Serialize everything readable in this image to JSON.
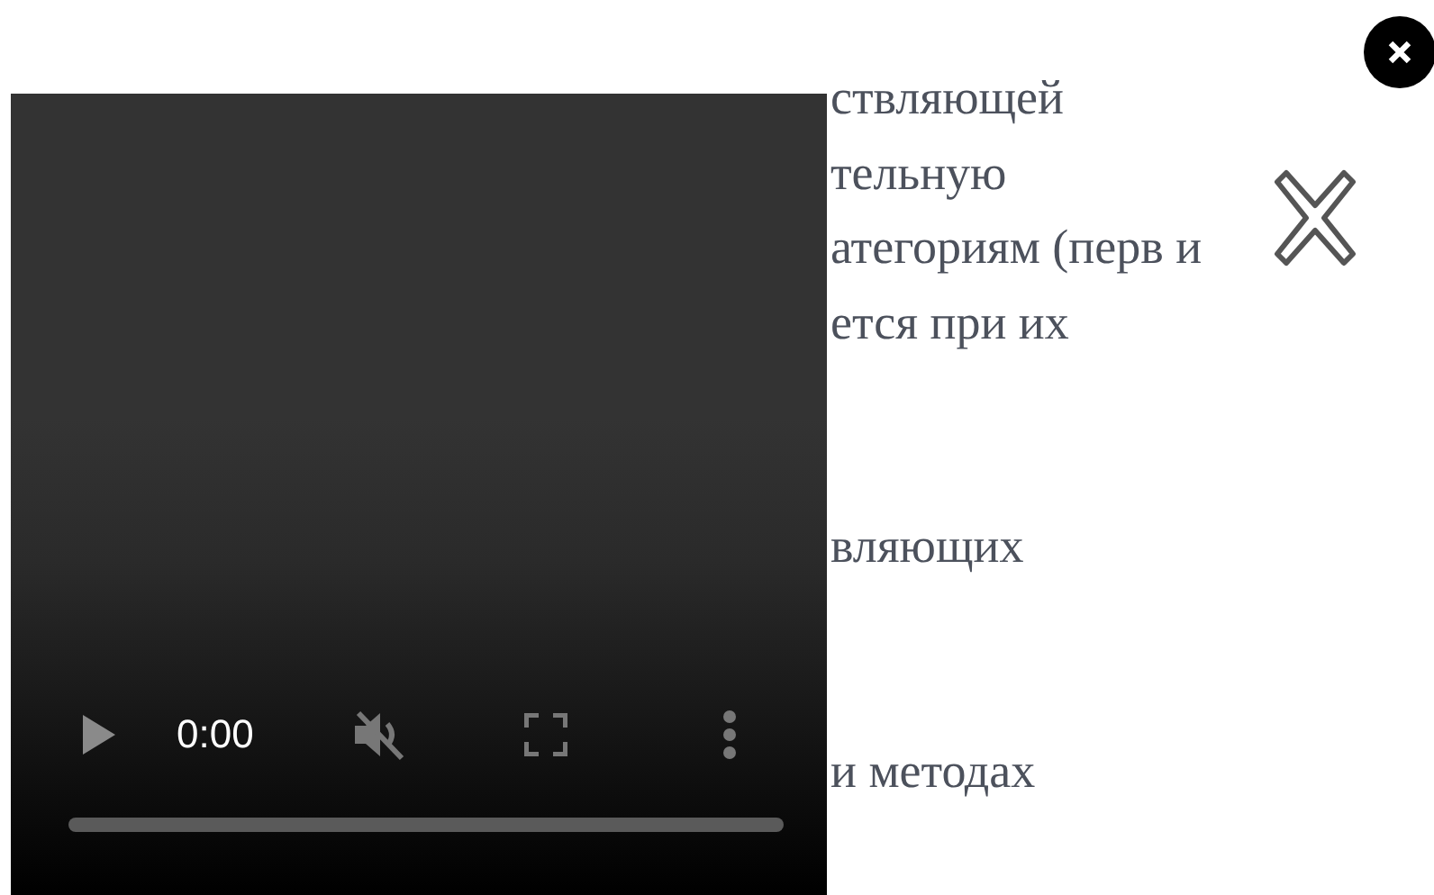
{
  "article": {
    "paragraphs": [
      {
        "lines": [
          "ствляющей",
          "тельную",
          "атегориям (перв и",
          "ется при их"
        ]
      },
      {
        "lines": [
          "вляющих"
        ]
      },
      {
        "lines": [
          "и методах"
        ]
      }
    ]
  },
  "video": {
    "time": "0:00",
    "muted": true,
    "level": 0
  }
}
